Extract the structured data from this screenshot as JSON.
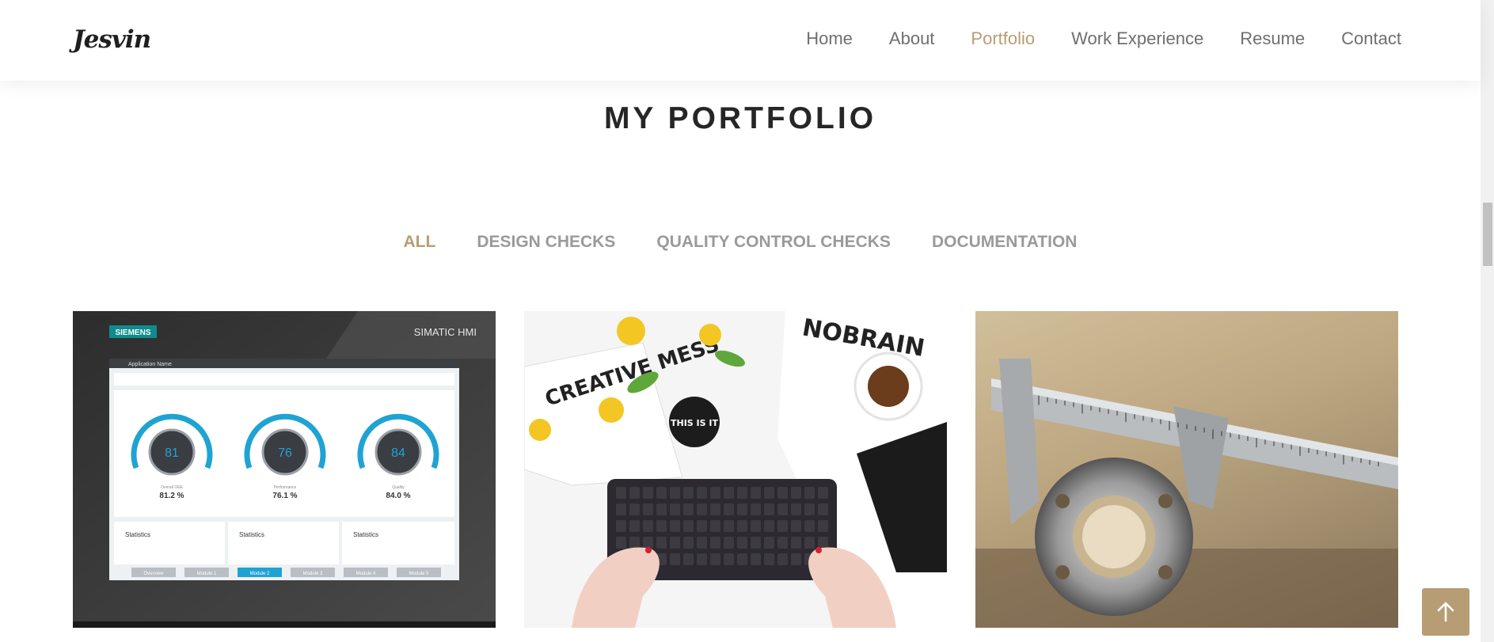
{
  "header": {
    "logo": "Jesvin",
    "nav": [
      {
        "label": "Home",
        "active": false
      },
      {
        "label": "About",
        "active": false
      },
      {
        "label": "Portfolio",
        "active": true
      },
      {
        "label": "Work Experience",
        "active": false
      },
      {
        "label": "Resume",
        "active": false
      },
      {
        "label": "Contact",
        "active": false
      }
    ]
  },
  "section": {
    "title": "MY PORTFOLIO"
  },
  "filters": [
    {
      "label": "ALL",
      "active": true
    },
    {
      "label": "DESIGN CHECKS",
      "active": false
    },
    {
      "label": "QUALITY CONTROL CHECKS",
      "active": false
    },
    {
      "label": "DOCUMENTATION",
      "active": false
    }
  ],
  "portfolio": {
    "hmi": {
      "brand": "SIEMENS",
      "product": "SIMATIC HMI",
      "app_name": "Application Name",
      "gauges": [
        {
          "value": "81",
          "label": "Overall OEE",
          "percent": "81.2 %"
        },
        {
          "value": "76",
          "label": "Performance",
          "percent": "76.1 %"
        },
        {
          "value": "84",
          "label": "Quality",
          "percent": "84.0 %"
        }
      ],
      "stat_label": "Statistics",
      "tabs": [
        "Overview",
        "Module 1",
        "Module 2",
        "Module 3",
        "Module 4",
        "Module 5"
      ],
      "active_tab": 2
    },
    "desk": {
      "text_a": "CREATIVE MESS",
      "text_b": "THIS IS IT",
      "text_c": "NOBRAIN"
    }
  },
  "colors": {
    "accent": "#b69d74",
    "nav_text": "#6f6f6f",
    "filter_text": "#9a9a9a",
    "hmi_blue": "#1fa3d3"
  },
  "icons": {
    "back_to_top": "arrow-up-icon"
  }
}
